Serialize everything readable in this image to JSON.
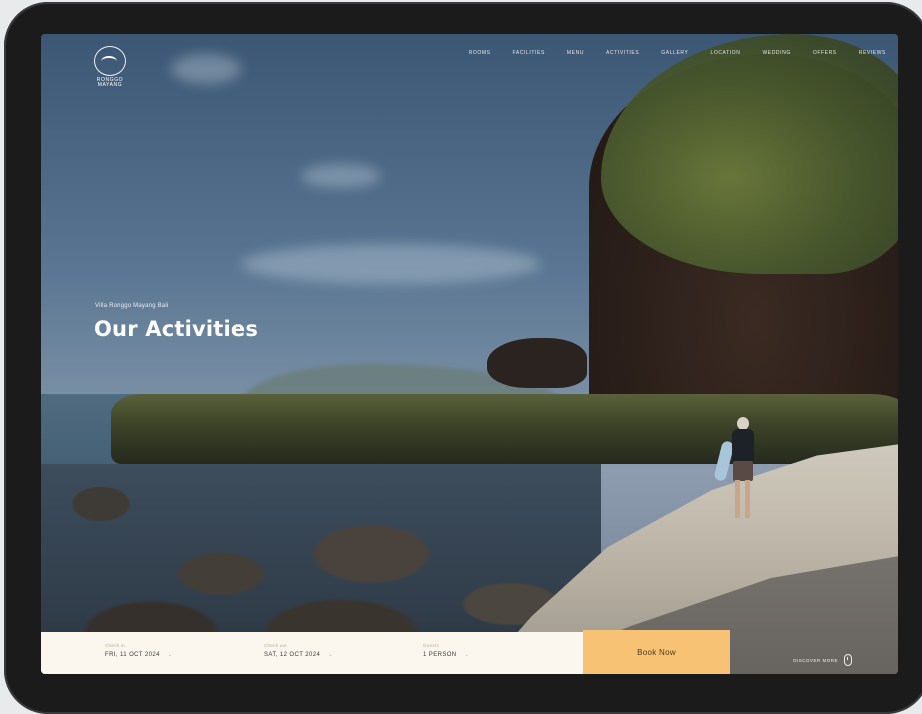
{
  "brand": {
    "logo_text": "RONGGO\nMAYANG"
  },
  "nav": {
    "items": [
      "ROOMS",
      "FACILITIES",
      "MENU",
      "ACTIVITIES",
      "GALLERY",
      "LOCATION",
      "WEDDING",
      "OFFERS",
      "REVIEWS"
    ]
  },
  "hero": {
    "eyebrow": "Villa Ronggo Mayang Bali",
    "title": "Our Activities"
  },
  "booking": {
    "checkin_label": "Check in",
    "checkin_value": "FRI, 11 OCT 2024",
    "checkout_label": "Check out",
    "checkout_value": "SAT, 12 OCT 2024",
    "guests_label": "Guests",
    "guests_value": "1 PERSON",
    "book_label": "Book Now"
  },
  "discover": {
    "label": "DISCOVER MORE"
  },
  "colors": {
    "accent": "#f8c275",
    "booking_bg": "#fbf7ee"
  }
}
